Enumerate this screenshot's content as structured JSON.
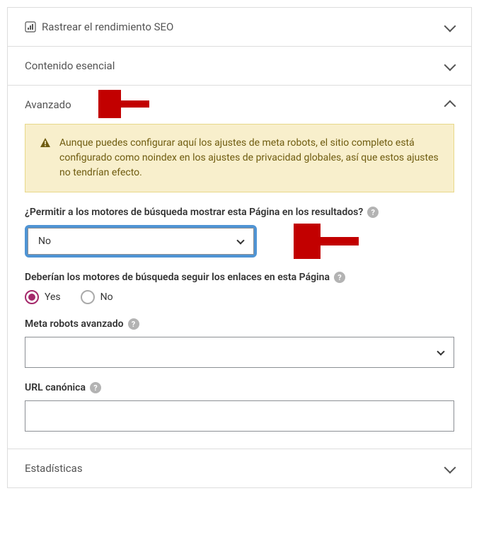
{
  "sections": {
    "seo_tracking": {
      "title": "Rastrear el rendimiento SEO"
    },
    "essential": {
      "title": "Contenido esencial"
    },
    "advanced": {
      "title": "Avanzado"
    },
    "stats": {
      "title": "Estadísticas"
    }
  },
  "advanced": {
    "alert": "Aunque puedes configurar aquí los ajustes de meta robots, el sitio completo está configurado como noindex en los ajustes de privacidad globales, así que estos ajustes no tendrían efecto.",
    "allow_search": {
      "label": "¿Permitir a los motores de búsqueda mostrar esta Página en los resultados?",
      "value": "No"
    },
    "follow_links": {
      "label": "Deberían los motores de búsqueda seguir los enlaces en esta Página",
      "options": {
        "yes": "Yes",
        "no": "No"
      },
      "selected": "yes"
    },
    "meta_robots": {
      "label": "Meta robots avanzado",
      "value": ""
    },
    "canonical": {
      "label": "URL canónica",
      "value": ""
    }
  },
  "help_char": "?"
}
